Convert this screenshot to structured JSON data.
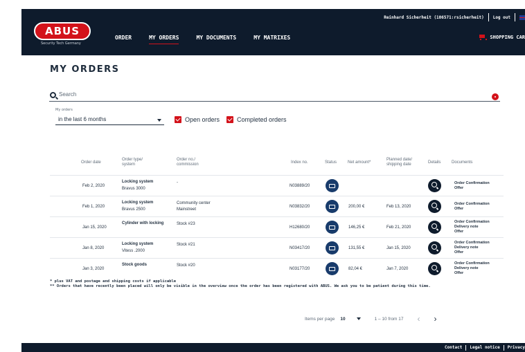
{
  "header": {
    "logo_text": "ABUS",
    "logo_subtitle": "Security Tech Germany",
    "nav": [
      {
        "label": "ORDER"
      },
      {
        "label": "MY ORDERS"
      },
      {
        "label": "MY DOCUMENTS"
      },
      {
        "label": "MY MATRIXES"
      }
    ],
    "user": "Reinhard Sicherheit (106571:rsicherheit)",
    "logout": "Log out",
    "cart": "SHOPPING CAR"
  },
  "page": {
    "title": "MY ORDERS",
    "search_placeholder": "Search"
  },
  "filter": {
    "label": "My orders",
    "selected": "in the last 6 months",
    "open_orders": "Open orders",
    "completed_orders": "Completed orders"
  },
  "table": {
    "headers": {
      "order_date": "Order date",
      "order_type_1": "Order type/",
      "order_type_2": "system",
      "order_no_1": "Order no./",
      "order_no_2": "commission",
      "index_no": "Index no.",
      "status": "Status",
      "net_amount": "Net amount*",
      "planned_1": "Planned date/",
      "planned_2": "shipping date",
      "details": "Details",
      "documents": "Documents"
    },
    "rows": [
      {
        "date": "Feb 2, 2020",
        "type": "Locking system",
        "system": "Bravus 3000",
        "order_no": "-",
        "commission": "",
        "index": "N03889/20",
        "amount": "",
        "planned": "",
        "docs": [
          "Order Confirmation",
          "Offer"
        ]
      },
      {
        "date": "Feb 1, 2020",
        "type": "Locking system",
        "system": "Bravus 2500",
        "order_no": "Community center",
        "commission": "Mainstreet",
        "index": "N03832/20",
        "amount": "200,00 €",
        "planned": "Feb 13, 2020",
        "docs": [
          "Order Confirmation",
          "Offer"
        ]
      },
      {
        "date": "Jan 15, 2020",
        "type": "Cylinder with locking",
        "system": "",
        "order_no": "Stock #23",
        "commission": "",
        "index": "H12680/20",
        "amount": "146,25 €",
        "planned": "Feb 21, 2020",
        "docs": [
          "Order Confirmation",
          "Delivery note",
          "Offer"
        ]
      },
      {
        "date": "Jan 8, 2020",
        "type": "Locking system",
        "system": "Vitess .2000",
        "order_no": "Stock #21",
        "commission": "",
        "index": "N03417/20",
        "amount": "131,55 €",
        "planned": "Jan 15, 2020",
        "docs": [
          "Order Confirmation",
          "Delivery note",
          "Offer"
        ]
      },
      {
        "date": "Jan 3, 2020",
        "type": "Stock goods",
        "system": "",
        "order_no": "Stock #20",
        "commission": "",
        "index": "N03177/20",
        "amount": "82,04 €",
        "planned": "Jan 7, 2020",
        "docs": [
          "Order Confirmation",
          "Delivery note",
          "Offer"
        ]
      }
    ]
  },
  "footnotes": {
    "line1": "* plus VAT and postage and shipping costs if applicable",
    "line2": "** Orders that have recently been placed will only be visible in the overview once the order has been registered with ABUS. We ask you to be patient during this time."
  },
  "pager": {
    "items_label": "Items per page",
    "per_page": "10",
    "range": "1 – 10 from 17",
    "prev": "‹",
    "next": "›"
  },
  "footer": {
    "contact": "Contact",
    "legal": "Legal notice",
    "privacy": "Privacy"
  }
}
